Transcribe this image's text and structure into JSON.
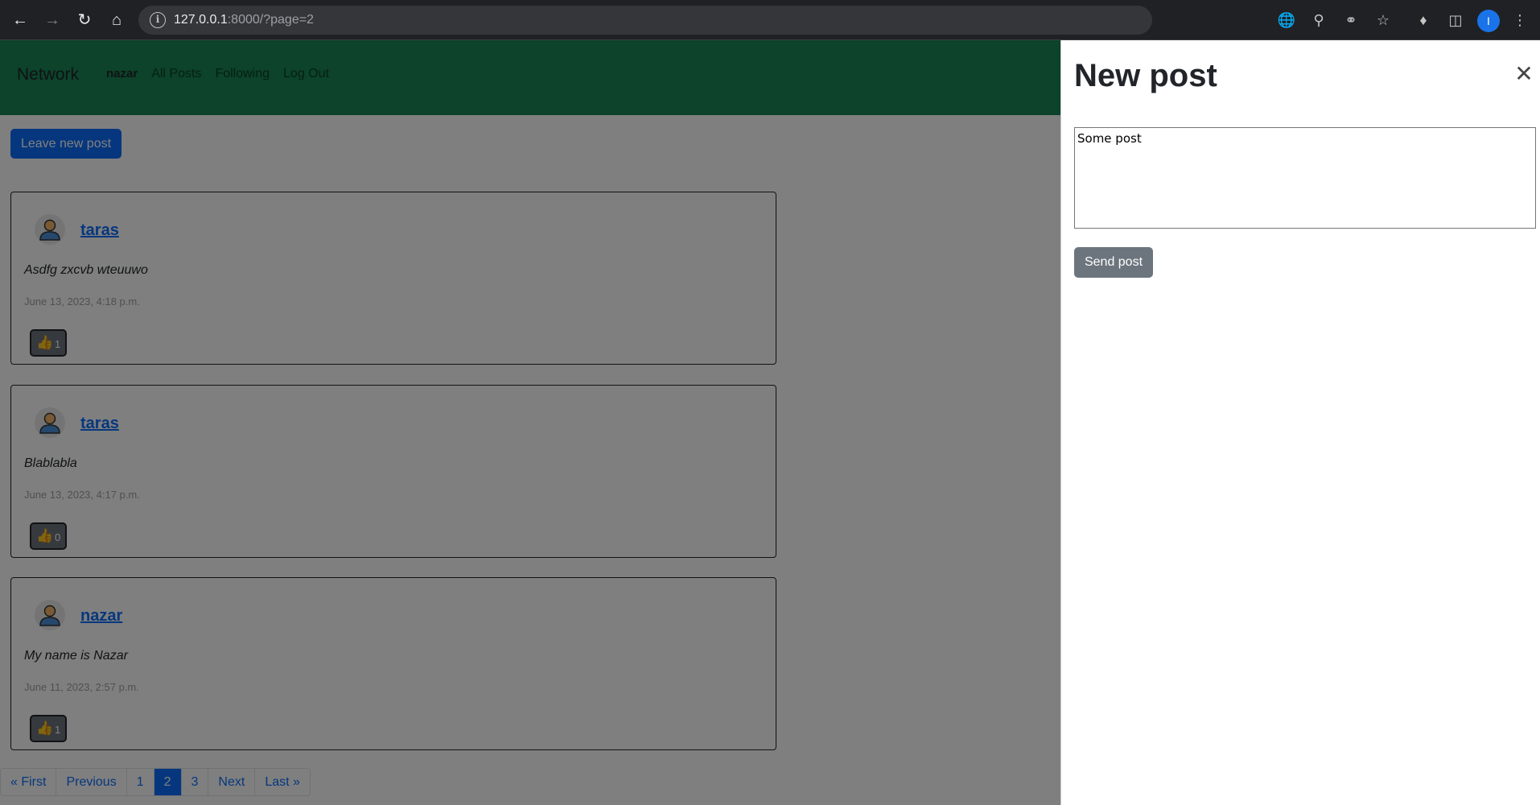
{
  "browser": {
    "url_host": "127.0.0.1",
    "url_rest": ":8000/?page=2",
    "profile_initial": "I"
  },
  "navbar": {
    "brand": "Network",
    "user": "nazar",
    "links": [
      "All Posts",
      "Following",
      "Log Out"
    ]
  },
  "leave_button": "Leave new post",
  "posts": [
    {
      "author": "taras",
      "content": "Asdfg zxcvb wteuuwo",
      "date": "June 13, 2023, 4:18 p.m.",
      "likes": "1"
    },
    {
      "author": "taras",
      "content": "Blablabla",
      "date": "June 13, 2023, 4:17 p.m.",
      "likes": "0"
    },
    {
      "author": "nazar",
      "content": "My name is Nazar",
      "date": "June 11, 2023, 2:57 p.m.",
      "likes": "1"
    }
  ],
  "pagination": [
    "« First",
    "Previous",
    "1",
    "2",
    "3",
    "Next",
    "Last »"
  ],
  "pagination_active": "2",
  "offcanvas": {
    "title": "New post",
    "textarea_value": "Some post",
    "send_label": "Send post"
  },
  "colors": {
    "navbar": "#198754",
    "primary": "#0d6efd",
    "secondary": "#6c757d"
  }
}
